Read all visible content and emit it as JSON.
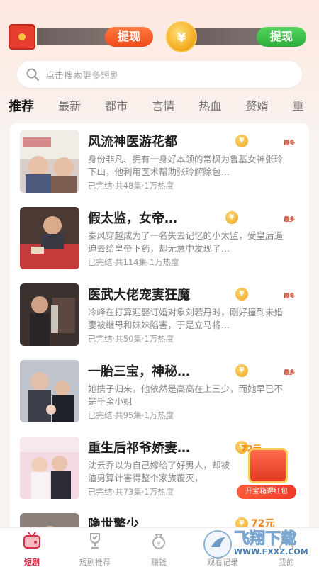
{
  "rewards": {
    "withdraw_left": "提现",
    "coin_symbol": "¥",
    "withdraw_right": "提现"
  },
  "search": {
    "placeholder": "点击搜索更多短剧"
  },
  "tabs": [
    {
      "label": "推荐",
      "active": true
    },
    {
      "label": "最新"
    },
    {
      "label": "都市"
    },
    {
      "label": "言情"
    },
    {
      "label": "热血"
    },
    {
      "label": "赘婿"
    },
    {
      "label": "重"
    }
  ],
  "dramas": [
    {
      "title": "风流神医游花都",
      "desc": "身份非凡、拥有一身好本领的常枫为鲁基女神张玲下山，他利用医术帮助张玲解除包…",
      "meta": "已完结·共48集·1万热度",
      "max_tag": "最多"
    },
    {
      "title": "假太监，女帝…",
      "desc": "秦风穿越成为了一名失去记忆的小太监，受皇后逼迫去给皇帝下药，却无意中发现了…",
      "meta": "已完结·共114集·1万热度",
      "max_tag": "最多"
    },
    {
      "title": "医武大佬宠妻狂魔",
      "desc": "冷峰在打算迎娶订婚对象刘若丹时，刚好撞到未婚妻被继母和妹妹陷害，于是立马将…",
      "meta": "已完结·共50集·1万热度",
      "max_tag": "最多"
    },
    {
      "title": "一胎三宝，神秘…",
      "desc": "她携子归来，他依然是高高在上三少，而她早已不是千金小姐",
      "meta": "已完结·共95集·1万热度",
      "max_tag": "最多"
    },
    {
      "title": "重生后祁爷娇妻…",
      "desc": "沈云乔以为自己嫁给了好男人，却被渣男算计害得整个家族覆灭，",
      "meta": "已完结·共73集·1万热度",
      "reward": "72元"
    },
    {
      "title": "隐世擎少",
      "reward": "72元"
    }
  ],
  "treasure": {
    "label": "开宝箱得红包",
    "reward": "72元"
  },
  "nav": [
    {
      "label": "短剧",
      "active": true
    },
    {
      "label": "短剧推荐"
    },
    {
      "label": "赚钱"
    },
    {
      "label": "观看记录"
    },
    {
      "label": "我的"
    }
  ],
  "watermark": {
    "brand": "飞翔下载",
    "url": "WWW.FXXZ.COM"
  }
}
